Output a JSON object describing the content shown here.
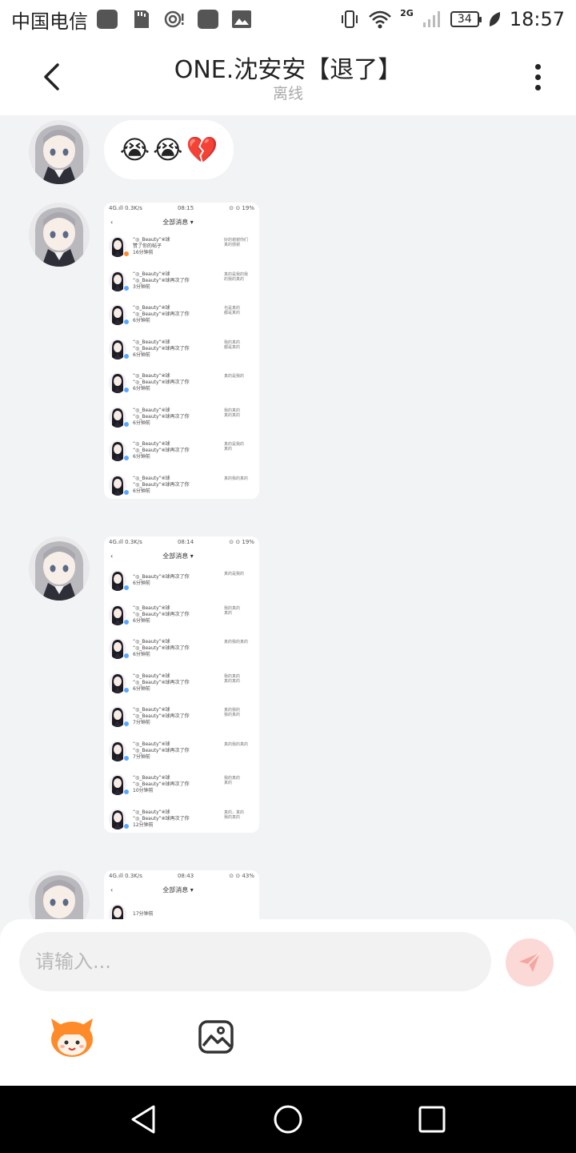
{
  "status_bar": {
    "carrier": "中国电信",
    "network": "2G",
    "battery": "34",
    "time": "18:57",
    "icons": [
      "app-icon",
      "sd-card-icon",
      "hotspot-icon",
      "app-icon",
      "gallery-icon",
      "vibrate-icon",
      "wifi-icon",
      "signal-icon",
      "leaf-icon"
    ]
  },
  "header": {
    "title": "ONE.沈安安【退了】",
    "status": "离线",
    "icons": {
      "back": "chevron-left-icon",
      "more": "more-vertical-icon"
    }
  },
  "messages": [
    {
      "type": "emoji",
      "content": [
        "😭",
        "😭",
        "💔"
      ]
    },
    {
      "type": "image",
      "screenshot": {
        "status": {
          "left": "4G.ıll 0.3K/s",
          "time": "08:15",
          "right": "⊙ ⊙ 19%"
        },
        "title": "全部消息 ▾",
        "rows": [
          {
            "name": "“◎_Beauty”※球",
            "text": "赞了你的帖子",
            "time": "16分钟前",
            "side": "好的谢谢你们\n真的感谢",
            "badge": "orange"
          },
          {
            "name": "“◎_Beauty”※球",
            "text": "“◎_Beauty”※球再次了你",
            "time": "3分钟前",
            "side": "真的是我的我\n的我的真的",
            "badge": "blue"
          },
          {
            "name": "“◎_Beauty”※球",
            "text": "“◎_Beauty”※球再次了你",
            "time": "6分钟前",
            "side": "也是真的\n都是真的",
            "badge": "blue"
          },
          {
            "name": "“◎_Beauty”※球",
            "text": "“◎_Beauty”※球再次了你",
            "time": "6分钟前",
            "side": "我的真的\n都是真的",
            "badge": "blue"
          },
          {
            "name": "“◎_Beauty”※球",
            "text": "“◎_Beauty”※球再次了你",
            "time": "6分钟前",
            "side": "真的是我的",
            "badge": "blue"
          },
          {
            "name": "“◎_Beauty”※球",
            "text": "“◎_Beauty”※球再次了你",
            "time": "6分钟前",
            "side": "我的真的\n真的真的",
            "badge": "blue"
          },
          {
            "name": "“◎_Beauty”※球",
            "text": "“◎_Beauty”※球再次了你",
            "time": "6分钟前",
            "side": "真的是我的\n真的",
            "badge": "blue"
          },
          {
            "name": "“◎_Beauty”※球",
            "text": "“◎_Beauty”※球再次了你",
            "time": "6分钟前",
            "side": "真的我的真的",
            "badge": "blue"
          }
        ]
      }
    },
    {
      "type": "image",
      "screenshot": {
        "status": {
          "left": "4G.ıll 0.3K/s",
          "time": "08:14",
          "right": "⊙ ⊙ 19%"
        },
        "title": "全部消息 ▾",
        "rows": [
          {
            "name": "",
            "text": "“◎_Beauty”※球再次了你",
            "time": "6分钟前",
            "side": "真的是我的",
            "badge": "blue"
          },
          {
            "name": "“◎_Beauty”※球",
            "text": "“◎_Beauty”※球再次了你",
            "time": "6分钟前",
            "side": "我的真的\n真的",
            "badge": "blue"
          },
          {
            "name": "“◎_Beauty”※球",
            "text": "“◎_Beauty”※球再次了你",
            "time": "6分钟前",
            "side": "真的我的真的",
            "badge": "blue"
          },
          {
            "name": "“◎_Beauty”※球",
            "text": "“◎_Beauty”※球再次了你",
            "time": "6分钟前",
            "side": "我的真的\n真的真的",
            "badge": "blue"
          },
          {
            "name": "“◎_Beauty”※球",
            "text": "“◎_Beauty”※球再次了你",
            "time": "7分钟前",
            "side": "真的我的\n我的真的",
            "badge": "blue"
          },
          {
            "name": "“◎_Beauty”※球",
            "text": "“◎_Beauty”※球再次了你",
            "time": "7分钟前",
            "side": "真的我的真的",
            "badge": "blue"
          },
          {
            "name": "“◎_Beauty”※球",
            "text": "“◎_Beauty”※球再次了你",
            "time": "10分钟前",
            "side": "我的真的\n真的",
            "badge": "blue"
          },
          {
            "name": "“◎_Beauty”※球",
            "text": "“◎_Beauty”※球再次了你",
            "time": "12分钟前",
            "side": "真的，真的\n我的真的",
            "badge": "blue"
          }
        ]
      }
    },
    {
      "type": "image",
      "screenshot": {
        "status": {
          "left": "4G.ıll 0.3K/s",
          "time": "08:43",
          "right": "⊙ ⊙ 43%"
        },
        "title": "全部消息 ▾",
        "rows": [
          {
            "name": "",
            "text": "",
            "time": "17分钟前",
            "side": "",
            "badge": "blue"
          }
        ]
      }
    }
  ],
  "composer": {
    "placeholder": "请输入...",
    "icons": {
      "send": "paper-plane-icon",
      "emoji": "mascot-emoji-icon",
      "image": "image-icon"
    }
  },
  "nav": {
    "icons": [
      "back-triangle-icon",
      "home-circle-icon",
      "recents-square-icon"
    ]
  },
  "colors": {
    "bubble_bg": "#ffffff",
    "chat_bg": "#f2f3f5",
    "send_bg": "#fbd9d7",
    "send_icon": "#f6a6a0",
    "mascot": "#ff8a2a"
  }
}
